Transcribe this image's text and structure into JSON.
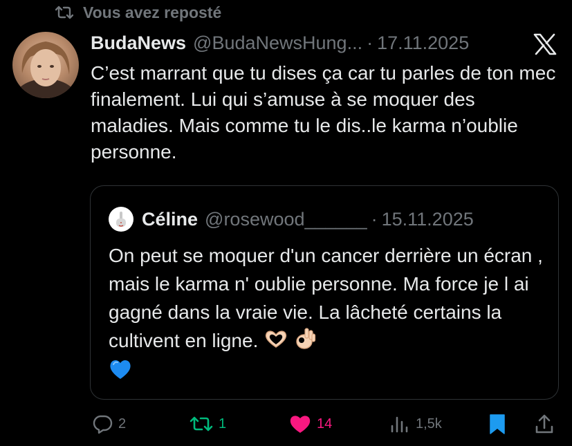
{
  "repost": {
    "label": "Vous avez reposté"
  },
  "tweet": {
    "author_name": "BudaNews",
    "author_handle": "@BudaNewsHung...",
    "separator": "·",
    "date": "17.11.2025",
    "text": "C’est marrant que tu dises ça car tu parles de ton mec finalement. Lui qui s’amuse à se moquer des maladies. Mais comme tu le dis..le karma n’oublie personne."
  },
  "quote": {
    "author_name": "Céline",
    "author_handle": "@rosewood______",
    "separator": "·",
    "date": "15.11.2025",
    "text": "On peut se moquer d'un cancer derrière un écran , mais le karma n' oublie personne. Ma force je l ai gagné dans la vraie vie. La lâcheté certains la cultivent en ligne."
  },
  "actions": {
    "replies": "2",
    "reposts": "1",
    "likes": "14",
    "views": "1,5k"
  },
  "icons": {
    "repost": "repost-icon",
    "x_logo": "x-logo-icon",
    "reply": "reply-icon",
    "like": "heart-icon",
    "views": "views-icon",
    "bookmark": "bookmark-icon",
    "share": "share-icon",
    "emojis": [
      "heart-hands-emoji",
      "ok-hand-emoji",
      "blue-heart-emoji"
    ]
  },
  "colors": {
    "background": "#000000",
    "text": "#e7e9ea",
    "muted": "#71767b",
    "repost_active": "#00ba7c",
    "like_active": "#f91880",
    "bookmark_active": "#1d9bf0"
  }
}
